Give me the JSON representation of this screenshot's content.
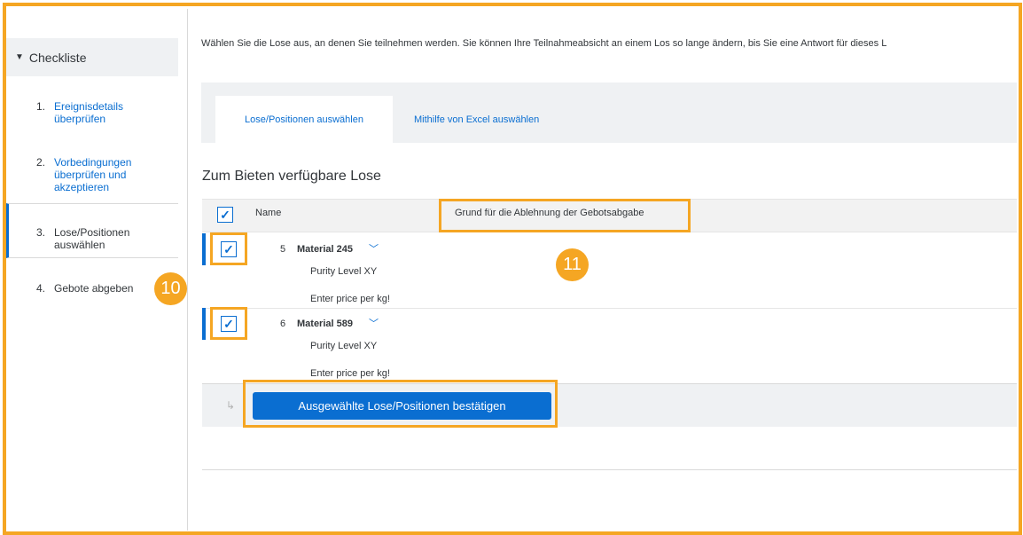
{
  "sidebar": {
    "header": "Checkliste",
    "items": [
      {
        "num": "1.",
        "label": "Ereignisdetails überprüfen"
      },
      {
        "num": "2.",
        "label": "Vorbedingungen überprüfen und akzeptieren"
      },
      {
        "num": "3.",
        "label": "Lose/Positionen auswählen"
      },
      {
        "num": "4.",
        "label": "Gebote abgeben"
      }
    ]
  },
  "badges": {
    "b10": "10",
    "b11": "11"
  },
  "main": {
    "intro": "Wählen Sie die Lose aus, an denen Sie teilnehmen werden. Sie können Ihre Teilnahmeabsicht an einem Los so lange ändern, bis Sie eine Antwort für dieses L",
    "tabs": [
      {
        "label": "Lose/Positionen auswählen"
      },
      {
        "label": "Mithilfe von Excel auswählen"
      }
    ],
    "section_title": "Zum Bieten verfügbare Lose",
    "columns": {
      "name": "Name",
      "reason": "Grund für die Ablehnung der Gebotsabgabe"
    },
    "rows": [
      {
        "num": "5",
        "title": "Material 245",
        "sub1": "Purity Level XY",
        "sub2": "Enter price per kg!"
      },
      {
        "num": "6",
        "title": "Material 589",
        "sub1": "Purity Level XY",
        "sub2": "Enter price per kg!"
      }
    ],
    "confirm_label": "Ausgewählte Lose/Positionen bestätigen"
  },
  "icons": {
    "check": "✓",
    "chevron": "﹀",
    "triangle": "▼",
    "enter_arrow": "↳"
  },
  "colors": {
    "accent": "#0a6ed1",
    "highlight": "#f5a623"
  }
}
